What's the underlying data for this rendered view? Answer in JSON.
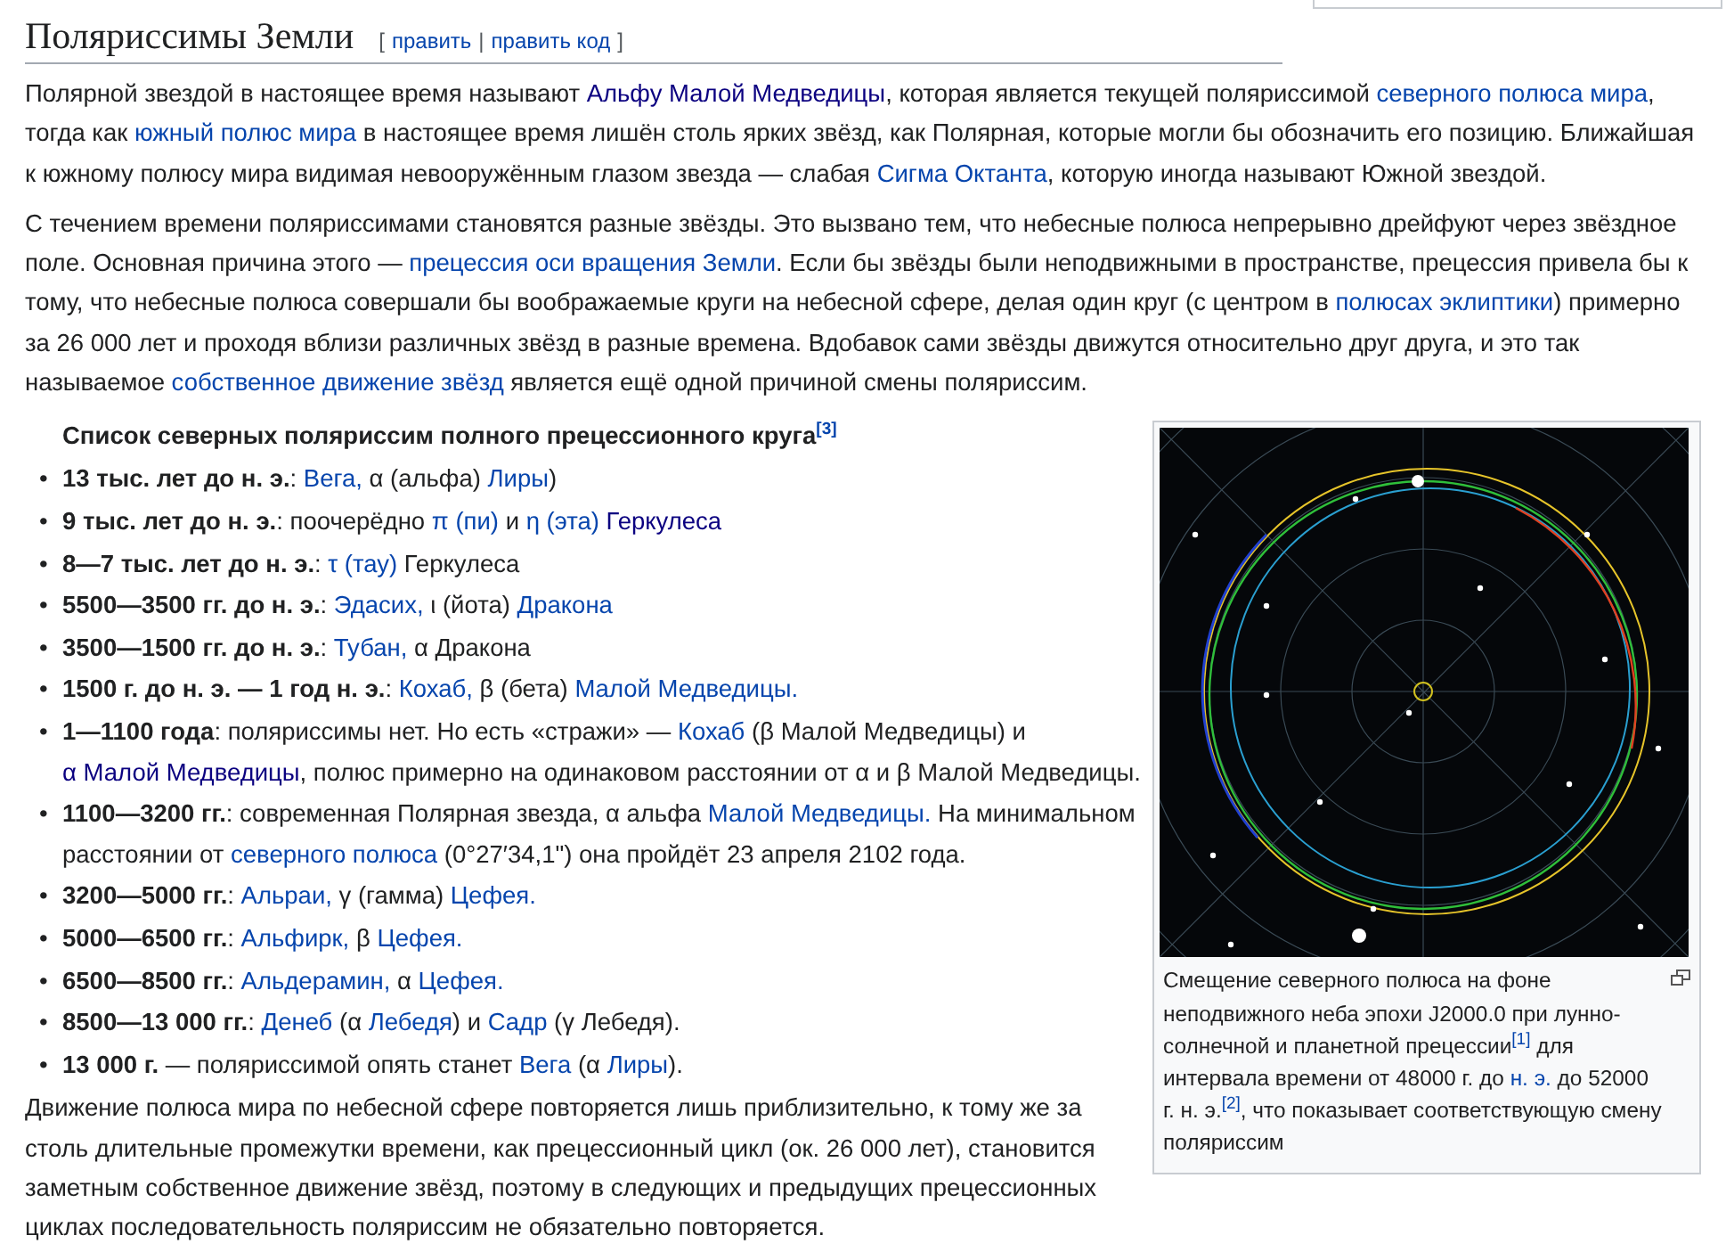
{
  "heading": {
    "title": "Поляриссимы Земли",
    "open_bracket": "[",
    "separator": "|",
    "close_bracket": "]",
    "edit_links": [
      {
        "label": "править"
      },
      {
        "label": "править код"
      }
    ]
  },
  "intro_paragraphs": [
    [
      {
        "kind": "text",
        "text": "Полярной звездой в настоящее время называют "
      },
      {
        "kind": "visited",
        "text": "Альфу Малой Медведицы"
      },
      {
        "kind": "text",
        "text": ", которая является текущей поляриссимой "
      },
      {
        "kind": "link",
        "text": "северного полюса мира"
      },
      {
        "kind": "text",
        "text": ", тогда как "
      },
      {
        "kind": "link",
        "text": "южный полюс мира"
      },
      {
        "kind": "text",
        "text": " в настоящее время лишён столь ярких звёзд, как Полярная, которые могли бы обозначить его позицию. Ближайшая к южному полюсу мира видимая невооружённым глазом звезда — слабая "
      },
      {
        "kind": "link",
        "text": "Сигма Октанта"
      },
      {
        "kind": "text",
        "text": ", которую иногда называют Южной звездой."
      }
    ],
    [
      {
        "kind": "text",
        "text": "С течением времени поляриссимами становятся разные звёзды. Это вызвано тем, что небесные полюса непрерывно дрейфуют через звёздное поле. Основная причина этого — "
      },
      {
        "kind": "link",
        "text": "прецессия оси вращения Земли"
      },
      {
        "kind": "text",
        "text": ". Если бы звёзды были неподвижными в пространстве, прецессия привела бы к тому, что небесные полюса совершали бы воображаемые круги на небесной сфере, делая один круг (с центром в "
      },
      {
        "kind": "link",
        "text": "полюсах эклиптики"
      },
      {
        "kind": "text",
        "text": ") примерно за 26 000 лет и проходя вблизи различных звёзд в разные времена. Вдобавок сами звёзды движутся относительно друг друга, и это так называемое "
      },
      {
        "kind": "link",
        "text": "собственное движение звёзд"
      },
      {
        "kind": "text",
        "text": " является ещё одной причиной смены поляриссим."
      }
    ]
  ],
  "list_title": [
    {
      "kind": "text",
      "text": "Список северных поляриссим полного прецессионного круга"
    },
    {
      "kind": "ref",
      "text": "[3]"
    }
  ],
  "pole_stars": [
    {
      "marker": "•",
      "period": "13 тыс. лет до н. э.",
      "segments": [
        {
          "kind": "text",
          "text": ": "
        },
        {
          "kind": "link",
          "text": "Вега,"
        },
        {
          "kind": "text",
          "text": " α (альфа) "
        },
        {
          "kind": "link",
          "text": "Лиры"
        },
        {
          "kind": "text",
          "text": ")"
        }
      ]
    },
    {
      "marker": "•",
      "period": "9 тыс. лет до н. э.",
      "segments": [
        {
          "kind": "text",
          "text": ": поочерёдно "
        },
        {
          "kind": "link",
          "text": "π (пи)"
        },
        {
          "kind": "text",
          "text": " и "
        },
        {
          "kind": "link",
          "text": "η (эта)"
        },
        {
          "kind": "visited",
          "text": " Геркулеса"
        }
      ]
    },
    {
      "marker": "•",
      "period": "8—7 тыс. лет до н. э.",
      "segments": [
        {
          "kind": "text",
          "text": ": "
        },
        {
          "kind": "link",
          "text": "τ (тау)"
        },
        {
          "kind": "text",
          "text": " Геркулеса"
        }
      ]
    },
    {
      "marker": "•",
      "period": "5500—3500 гг. до н. э.",
      "segments": [
        {
          "kind": "text",
          "text": ": "
        },
        {
          "kind": "link",
          "text": "Эдасих,"
        },
        {
          "kind": "text",
          "text": " ι (йота) "
        },
        {
          "kind": "link",
          "text": "Дракона"
        }
      ]
    },
    {
      "marker": "•",
      "period": "3500—1500 гг. до н. э.",
      "segments": [
        {
          "kind": "text",
          "text": ": "
        },
        {
          "kind": "link",
          "text": "Тубан,"
        },
        {
          "kind": "text",
          "text": " α Дракона"
        }
      ]
    },
    {
      "marker": "•",
      "period": "1500 г. до н. э. — 1 год н. э.",
      "segments": [
        {
          "kind": "text",
          "text": ": "
        },
        {
          "kind": "link",
          "text": "Кохаб,"
        },
        {
          "kind": "text",
          "text": " β (бета) "
        },
        {
          "kind": "link",
          "text": "Малой Медведицы."
        }
      ]
    },
    {
      "marker": "•",
      "period": "1—1100 года",
      "segments": [
        {
          "kind": "text",
          "text": ": поляриссимы нет. Но есть «стражи» — "
        },
        {
          "kind": "link",
          "text": "Кохаб"
        },
        {
          "kind": "text",
          "text": " (β Малой Медведицы) и "
        },
        {
          "kind": "visited",
          "text": "α Малой"
        },
        {
          "kind": "visited",
          "text": " Медведицы"
        },
        {
          "kind": "text",
          "text": ", полюс примерно на одинаковом расстоянии от α и β Малой Медведицы."
        }
      ]
    },
    {
      "marker": "•",
      "period": "1100—3200 гг.",
      "segments": [
        {
          "kind": "text",
          "text": ": современная Полярная звезда, α альфа "
        },
        {
          "kind": "link",
          "text": "Малой Медведицы."
        },
        {
          "kind": "text",
          "text": " На минимальном расстоянии от "
        },
        {
          "kind": "link",
          "text": "северного полюса"
        },
        {
          "kind": "text",
          "text": " (0°27′34,1\") она пройдёт 23 апреля 2102 года."
        }
      ]
    },
    {
      "marker": "•",
      "period": "3200—5000 гг.",
      "segments": [
        {
          "kind": "text",
          "text": ": "
        },
        {
          "kind": "link",
          "text": "Альраи,"
        },
        {
          "kind": "text",
          "text": " γ (гамма) "
        },
        {
          "kind": "link",
          "text": "Цефея."
        }
      ]
    },
    {
      "marker": "•",
      "period": "5000—6500 гг.",
      "segments": [
        {
          "kind": "text",
          "text": ": "
        },
        {
          "kind": "link",
          "text": "Альфирк,"
        },
        {
          "kind": "text",
          "text": " β "
        },
        {
          "kind": "link",
          "text": "Цефея."
        }
      ]
    },
    {
      "marker": "•",
      "period": "6500—8500 гг.",
      "segments": [
        {
          "kind": "text",
          "text": ": "
        },
        {
          "kind": "link",
          "text": "Альдерамин,"
        },
        {
          "kind": "text",
          "text": " α "
        },
        {
          "kind": "link",
          "text": "Цефея."
        }
      ]
    },
    {
      "marker": "•",
      "period": "8500—13 000 гг.",
      "segments": [
        {
          "kind": "text",
          "text": ": "
        },
        {
          "kind": "link",
          "text": "Денеб"
        },
        {
          "kind": "text",
          "text": " (α "
        },
        {
          "kind": "link",
          "text": "Лебедя"
        },
        {
          "kind": "text",
          "text": ") и "
        },
        {
          "kind": "link",
          "text": "Садр"
        },
        {
          "kind": "text",
          "text": " (γ Лебедя)."
        }
      ]
    },
    {
      "marker": "•",
      "period": "13 000 г.",
      "segments": [
        {
          "kind": "text",
          "text": " — поляриссимой опять станет "
        },
        {
          "kind": "link",
          "text": "Вега"
        },
        {
          "kind": "text",
          "text": " (α "
        },
        {
          "kind": "link",
          "text": "Лиры"
        },
        {
          "kind": "text",
          "text": ")."
        }
      ]
    }
  ],
  "closing_paragraph": [
    {
      "kind": "text",
      "text": "Движение полюса мира по небесной сфере повторяется лишь приблизительно, к тому же за столь длительные промежутки времени, как прецессионный цикл (ок. 26 000 лет), становится заметным собственное движение звёзд, поэтому в следующих и предыдущих прецессионных циклах последовательность поляриссим не обязательно повторяется."
    }
  ],
  "figure": {
    "caption": [
      {
        "kind": "text",
        "text": "Смещение северного полюса на фоне неподвижного неба эпохи J2000.0 при лунно-солнечной и планетной прецессии"
      },
      {
        "kind": "ref",
        "text": "[1]"
      },
      {
        "kind": "text",
        "text": " для интервала времени от 48000 г. до "
      },
      {
        "kind": "link",
        "text": "н. э."
      },
      {
        "kind": "text",
        "text": " до 52000 г. н. э."
      },
      {
        "kind": "ref",
        "text": "[2]"
      },
      {
        "kind": "text",
        "text": ", что показывает соответствующую смену поляриссим"
      }
    ]
  }
}
